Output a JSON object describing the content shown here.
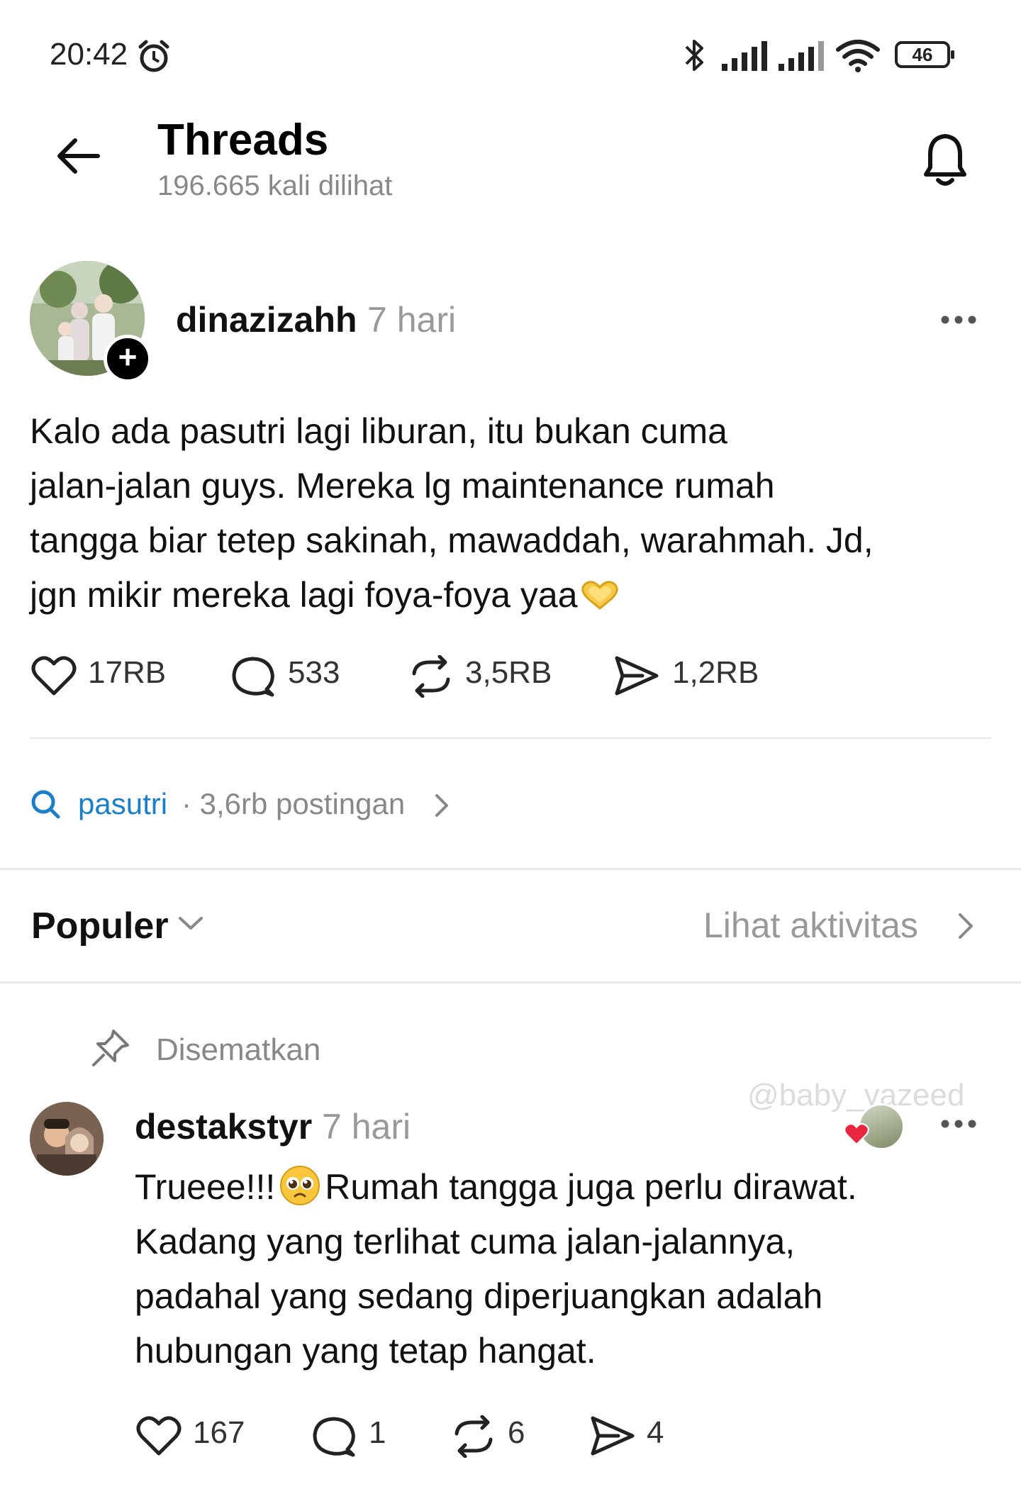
{
  "status_bar": {
    "time": "20:42",
    "battery": "46",
    "icons": [
      "alarm-icon",
      "bluetooth-icon",
      "signal-icon",
      "signal-icon",
      "wifi-icon",
      "battery-icon"
    ]
  },
  "header": {
    "title": "Threads",
    "views": "196.665 kali dilihat",
    "icons": [
      "back-arrow-icon",
      "bell-icon"
    ]
  },
  "post": {
    "username": "dinazizahh",
    "time": "7 hari",
    "text_lines": [
      "Kalo ada pasutri lagi liburan, itu bukan cuma",
      "jalan-jalan guys. Mereka lg maintenance rumah",
      "tangga biar tetep sakinah, mawaddah, warahmah. Jd,",
      "jgn mikir mereka lagi foya-foya yaa"
    ],
    "emoji": "heart-hands-emoji",
    "likes": "17RB",
    "replies": "533",
    "reposts": "3,5RB",
    "shares": "1,2RB"
  },
  "topic": {
    "tag": "pasutri",
    "meta": "· 3,6rb postingan"
  },
  "sort": {
    "label": "Populer",
    "activity": "Lihat aktivitas"
  },
  "comment": {
    "pinned_label": "Disematkan",
    "watermark": "@baby_yazeed",
    "username": "destakstyr",
    "time": "7 hari",
    "text_lines": [
      "Rumah tangga juga perlu dirawat.",
      "Kadang yang terlihat cuma jalan-jalannya,",
      "padahal yang sedang diperjuangkan adalah",
      "hubungan yang tetap hangat."
    ],
    "text_prefix": "Trueee!!!",
    "emoji": "pleading-face-emoji",
    "likes": "167",
    "replies": "1",
    "reposts": "6",
    "shares": "4"
  },
  "colors": {
    "link": "#1a7fc8",
    "muted": "#888888",
    "text": "#111111",
    "liked_heart": "#e8263f"
  }
}
